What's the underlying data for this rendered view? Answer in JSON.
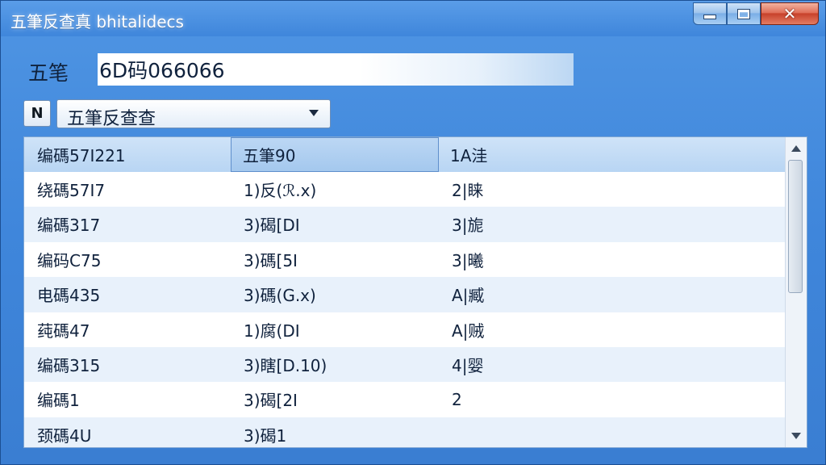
{
  "window": {
    "title": "五筆反查真 bhitalidecs",
    "controls": {
      "minimize": "minimize",
      "maximize": "maximize",
      "close": "✕"
    }
  },
  "input": {
    "label": "五笔",
    "value": "6D码066066"
  },
  "mode": {
    "button_glyph": "N",
    "selected": "五筆反查查"
  },
  "table": {
    "headers": [
      "编碼57I221",
      "五筆90",
      "1A洼"
    ],
    "rows": [
      [
        "绕碼57I7",
        "1)反(ℛ.x)",
        "2|睐"
      ],
      [
        "编碼317",
        "3)碣[DI",
        "3|旎"
      ],
      [
        "编码C75",
        "3)碼[5I",
        "3|曦"
      ],
      [
        "电碼435",
        "3)碼(G.x)",
        "A|臧"
      ],
      [
        "莼碼47",
        "1)腐(DI",
        "A|贼"
      ],
      [
        "编碼315",
        "3)瞎[D.10)",
        "4|婴"
      ],
      [
        "编碼1",
        "3)碣[2I",
        "2"
      ],
      [
        "颈碼4U",
        "3)碣1",
        ""
      ]
    ]
  },
  "colors": {
    "title_bar": "#4f95e3",
    "header_bg": "#cfe3f8",
    "alt_row": "#e8f1fb",
    "close_button": "#c8412b"
  }
}
